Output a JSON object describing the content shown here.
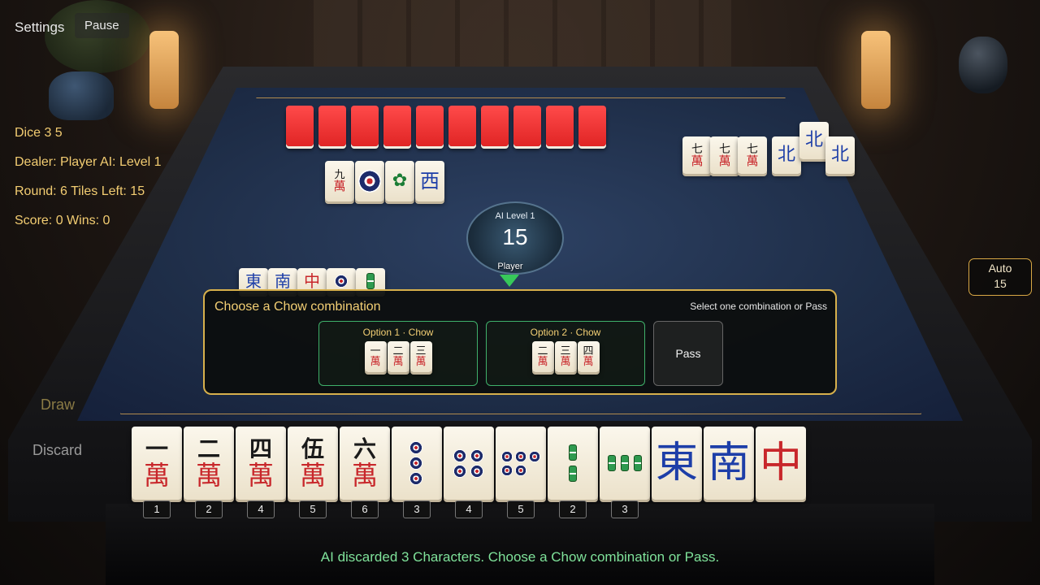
{
  "toolbar": {
    "settings_label": "Settings",
    "pause_label": "Pause"
  },
  "info": {
    "dice": "Dice 3 5",
    "dealer": "Dealer: Player  AI: Level 1",
    "round": "Round: 6  Tiles Left: 15",
    "score": "Score: 0  Wins: 0"
  },
  "center": {
    "ai_label": "AI Level 1",
    "tiles_left": "15",
    "turn_label": "Player"
  },
  "auto": {
    "label": "Auto",
    "value": "15"
  },
  "dialog": {
    "title": "Choose a Chow combination",
    "hint": "Select one combination or Pass",
    "options": [
      {
        "label": "Option 1 · Chow",
        "tiles": [
          "一",
          "二",
          "三"
        ]
      },
      {
        "label": "Option 2 · Chow",
        "tiles": [
          "二",
          "三",
          "四"
        ]
      }
    ],
    "pass_label": "Pass"
  },
  "actions": {
    "draw_label": "Draw",
    "discard_label": "Discard"
  },
  "opponent_melds": {
    "top_discards": [
      "九",
      "●",
      "🀢",
      "西"
    ],
    "right_meld": [
      "七",
      "七",
      "七",
      "北",
      "北",
      "北"
    ],
    "left_discards": [
      "東",
      "南",
      "中",
      "●",
      "‖"
    ]
  },
  "hand": [
    {
      "top": "一",
      "suit": "萬",
      "type": "char",
      "number": "1"
    },
    {
      "top": "二",
      "suit": "萬",
      "type": "char",
      "number": "2"
    },
    {
      "top": "四",
      "suit": "萬",
      "type": "char",
      "number": "4"
    },
    {
      "top": "伍",
      "suit": "萬",
      "type": "char",
      "number": "5"
    },
    {
      "top": "六",
      "suit": "萬",
      "type": "char",
      "number": "6"
    },
    {
      "type": "dots",
      "count": 3,
      "number": "3"
    },
    {
      "type": "dots",
      "count": 4,
      "number": "4"
    },
    {
      "type": "dots",
      "count": 5,
      "number": "5"
    },
    {
      "type": "bamboo",
      "count": 2,
      "number": "2"
    },
    {
      "type": "bamboo",
      "count": 3,
      "number": "3"
    },
    {
      "type": "wind",
      "glyph": "東",
      "color": "#1d3ea8"
    },
    {
      "type": "wind",
      "glyph": "南",
      "color": "#1d3ea8"
    },
    {
      "type": "dragon",
      "glyph": "中",
      "color": "#c8272b"
    }
  ],
  "status": "AI discarded 3 Characters. Choose a Chow combination or Pass.",
  "colors": {
    "accent": "#d7b04c",
    "status": "#7fe29a",
    "tile_back": "#f03a3a"
  }
}
